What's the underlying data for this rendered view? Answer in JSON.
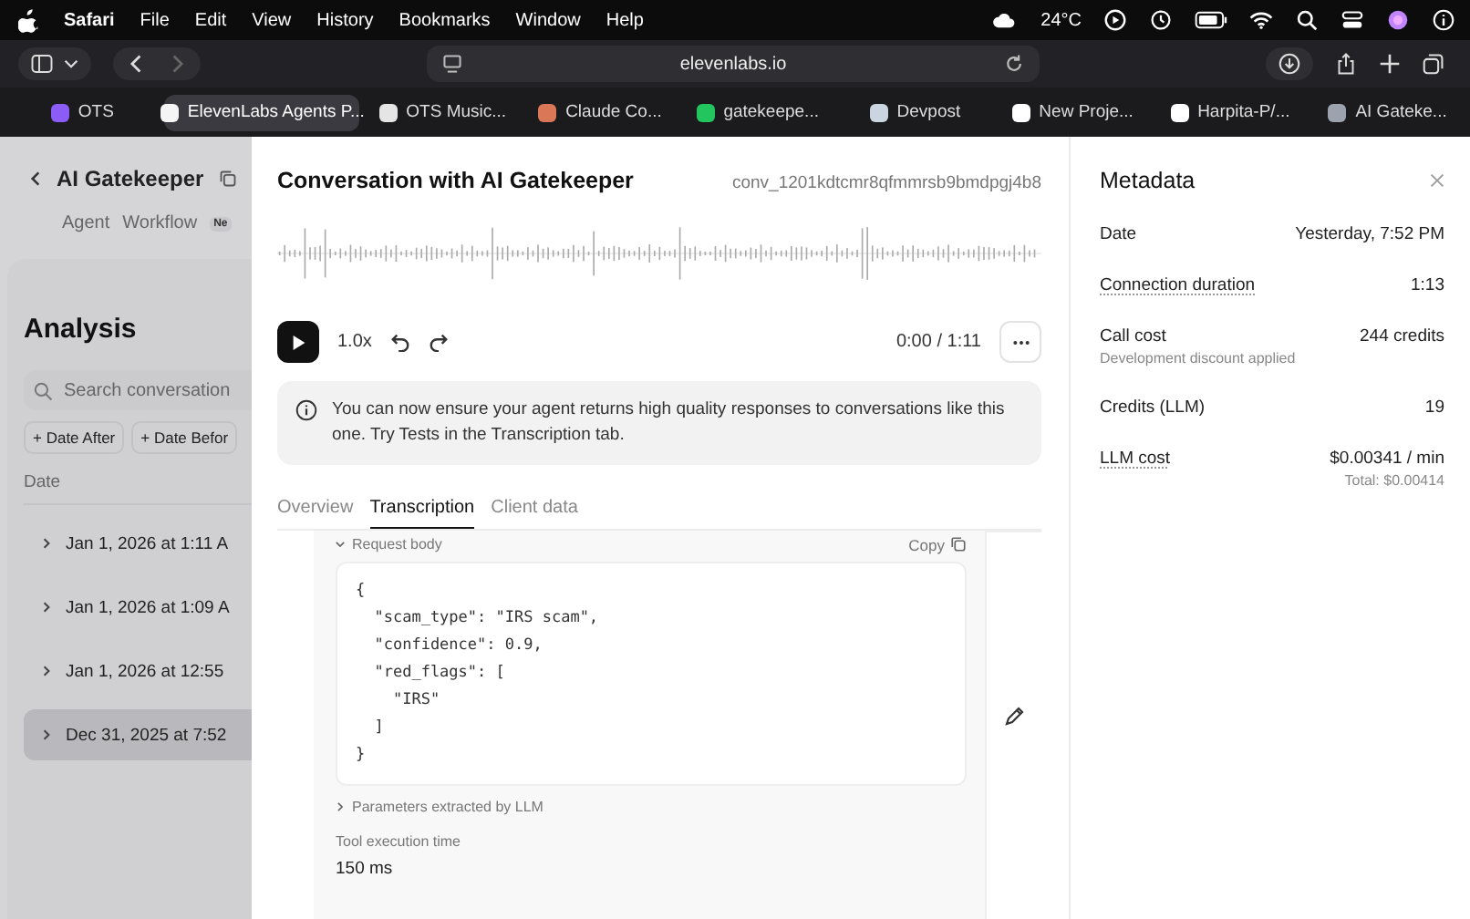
{
  "menu_bar": {
    "app": "Safari",
    "menus": [
      "File",
      "Edit",
      "View",
      "History",
      "Bookmarks",
      "Window",
      "Help"
    ],
    "temperature": "24°C"
  },
  "toolbar": {
    "url": "elevenlabs.io"
  },
  "tabs": [
    {
      "label": "OTS",
      "selected": false,
      "color": "#8b5cf6"
    },
    {
      "label": "ElevenLabs Agents P...",
      "selected": true,
      "color": "#f5f5f5"
    },
    {
      "label": "OTS Music...",
      "selected": false,
      "color": "#e5e5e5"
    },
    {
      "label": "Claude Co...",
      "selected": false,
      "color": "#d97757"
    },
    {
      "label": "gatekeepe...",
      "selected": false,
      "color": "#22c55e"
    },
    {
      "label": "Devpost",
      "selected": false,
      "color": "#cbd5e1"
    },
    {
      "label": "New Proje...",
      "selected": false,
      "color": "#ffffff"
    },
    {
      "label": "Harpita-P/...",
      "selected": false,
      "color": "#ffffff"
    },
    {
      "label": "AI Gateke...",
      "selected": false,
      "color": "#9ca3af"
    }
  ],
  "background_page": {
    "agent_name": "AI Gatekeeper",
    "nav": [
      "Agent",
      "Workflow"
    ],
    "nav_badge": "Ne",
    "heading": "Analysis",
    "search": {
      "placeholder": "Search conversation"
    },
    "filters": [
      "+ Date After",
      "+ Date Befor"
    ],
    "column": "Date",
    "rows": [
      {
        "date": "Jan 1, 2026 at 1:11 A",
        "selected": false
      },
      {
        "date": "Jan 1, 2026 at 1:09 A",
        "selected": false
      },
      {
        "date": "Jan 1, 2026 at 12:55",
        "selected": false
      },
      {
        "date": "Dec 31, 2025 at 7:52",
        "selected": true
      }
    ]
  },
  "conversation": {
    "title": "Conversation with AI Gatekeeper",
    "id": "conv_1201kdtcmr8qfmmrsb9bmdpgj4b8",
    "speed": "1.0x",
    "time": "0:00 / 1:11",
    "banner": "You can now ensure your agent returns high quality responses to conversations like this one. Try Tests in the Transcription tab.",
    "tabs": [
      {
        "label": "Overview",
        "selected": false
      },
      {
        "label": "Transcription",
        "selected": true
      },
      {
        "label": "Client data",
        "selected": false
      }
    ],
    "tool_call": {
      "request_body": {
        "label": "Request body",
        "expanded": true
      },
      "copy": "Copy",
      "code": [
        "{",
        "  \"scam_type\": \"IRS scam\",",
        "  \"confidence\": 0.9,",
        "  \"red_flags\": [",
        "    \"IRS\"",
        "  ]",
        "}"
      ],
      "parameters": {
        "label": "Parameters extracted by LLM",
        "expanded": false
      },
      "execution_label": "Tool execution time",
      "execution_value": "150 ms"
    }
  },
  "metadata": {
    "title": "Metadata",
    "rows": [
      {
        "label": "Date",
        "value": "Yesterday, 7:52 PM",
        "underlined": false
      },
      {
        "label": "Connection duration",
        "value": "1:13",
        "underlined": true
      },
      {
        "label": "Call cost",
        "value": "244 credits",
        "note": "Development discount applied",
        "underlined": false
      },
      {
        "label": "Credits (LLM)",
        "value": "19",
        "underlined": false
      },
      {
        "label": "LLM cost",
        "value": "$0.00341 / min",
        "value_note": "Total: $0.00414",
        "underlined": true
      }
    ]
  }
}
